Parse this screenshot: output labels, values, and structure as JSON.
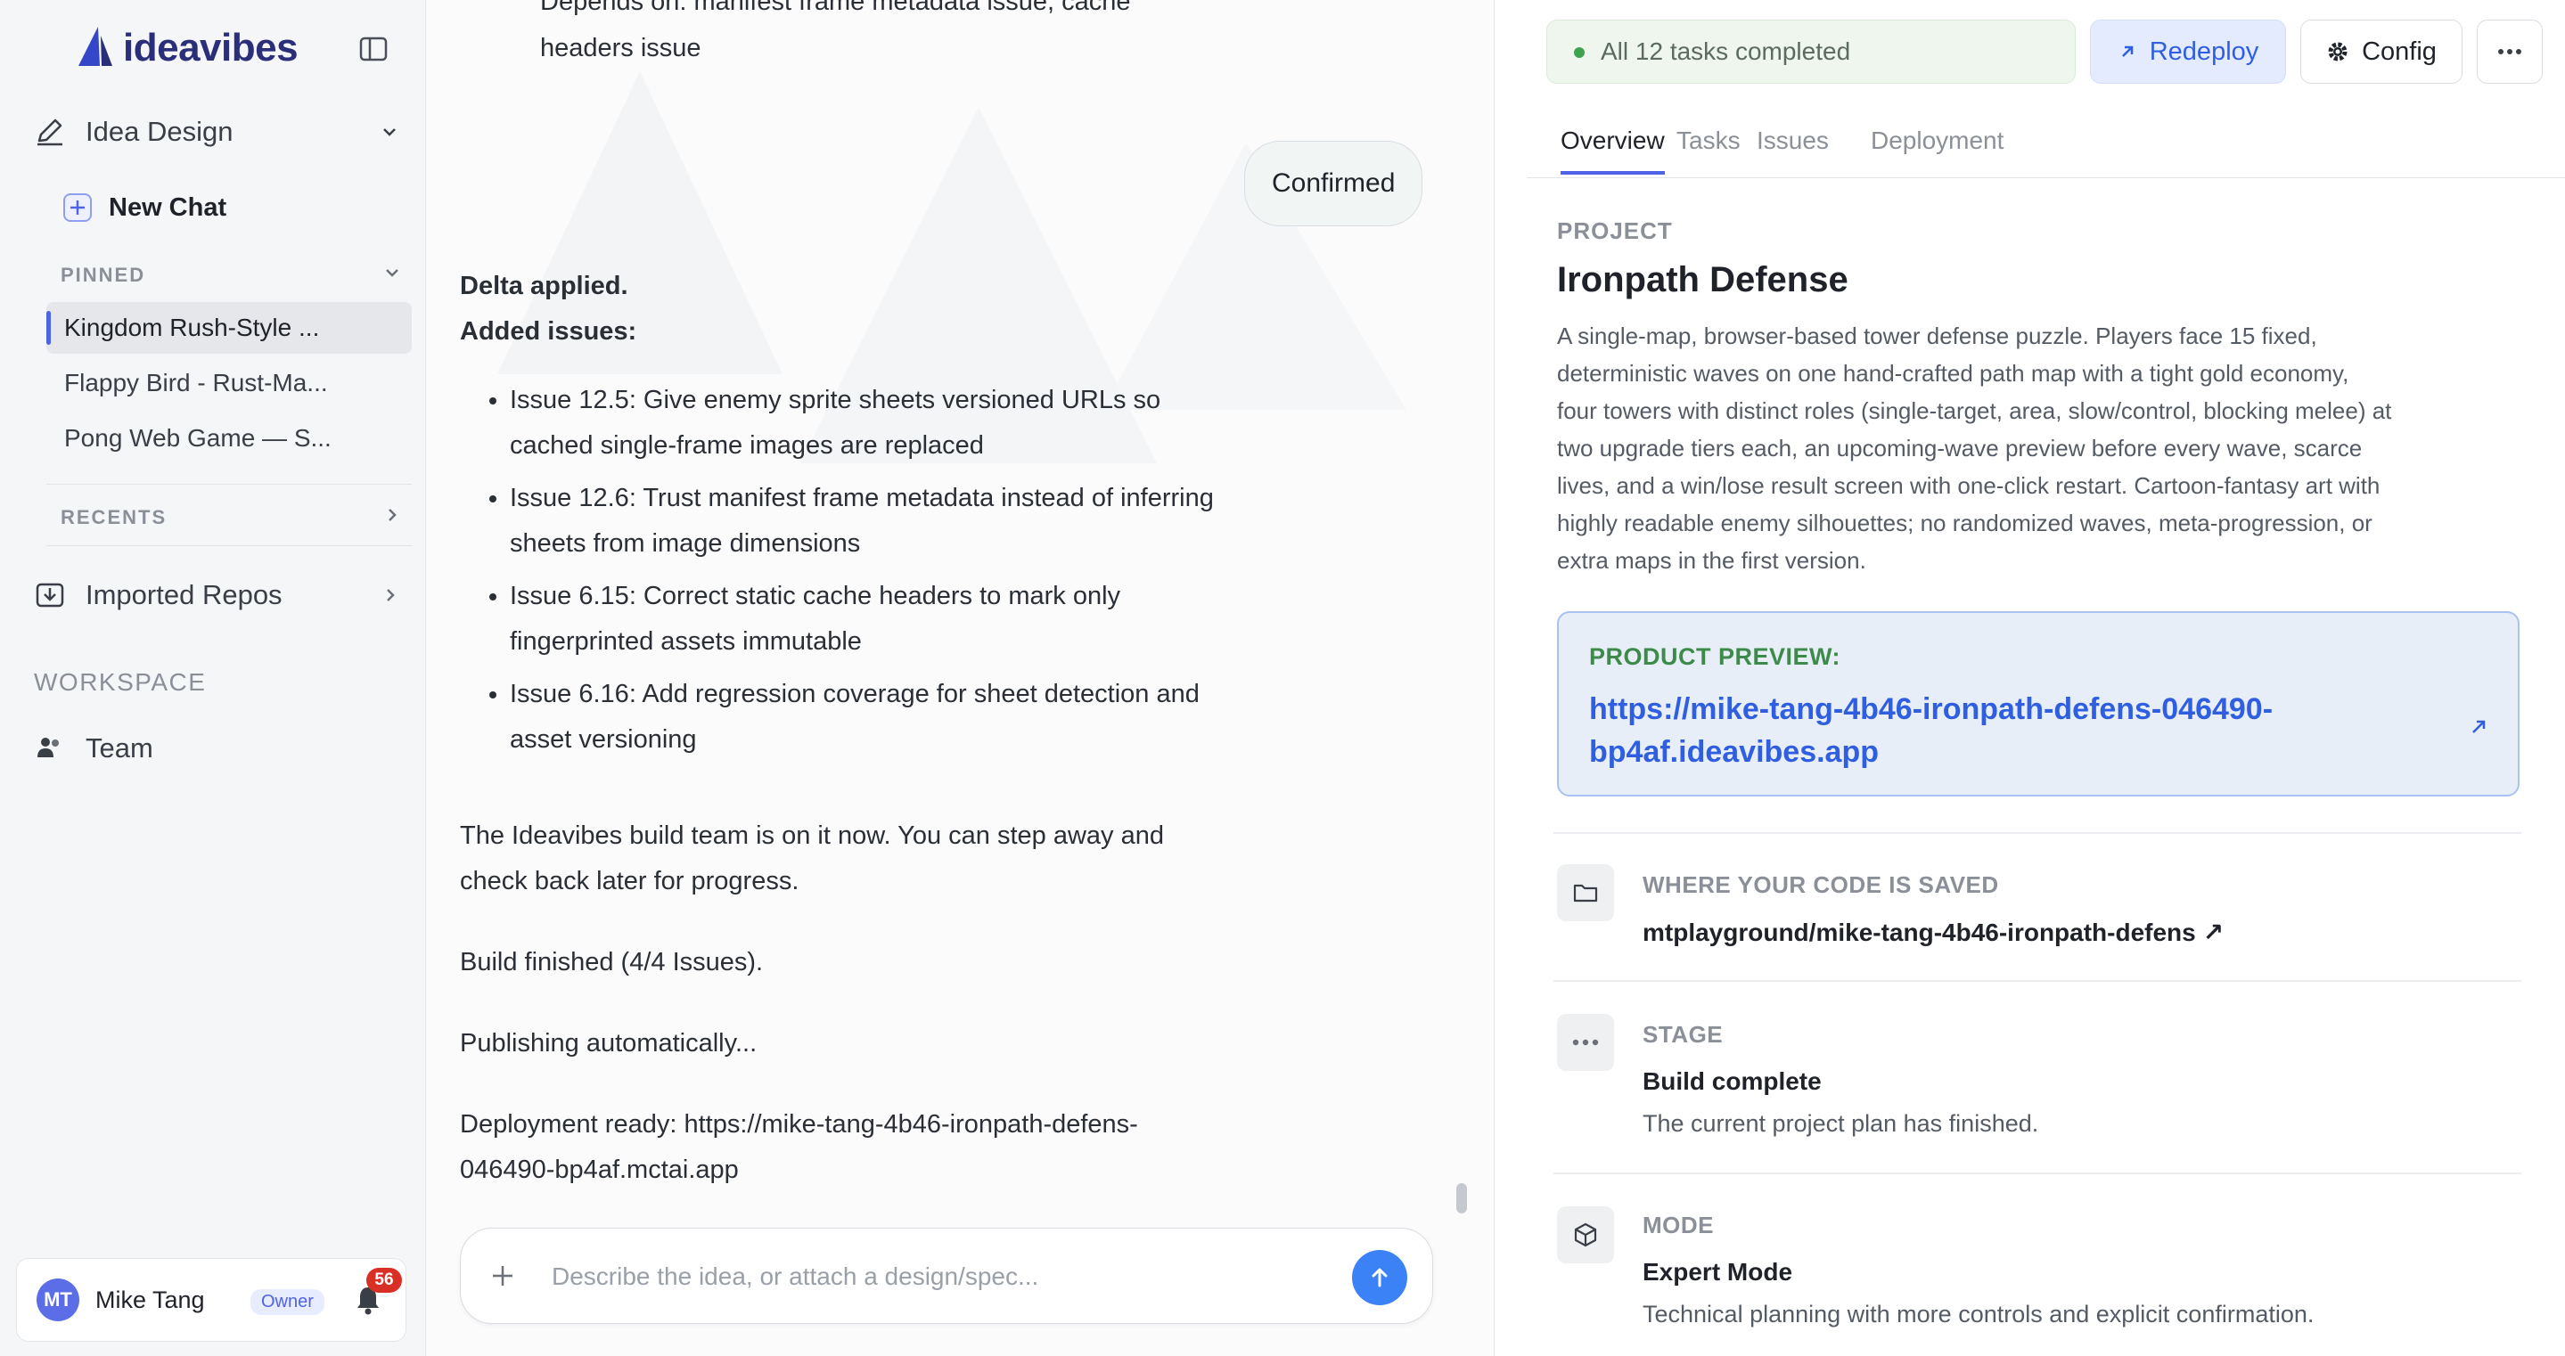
{
  "brand": {
    "name": "ideavibes"
  },
  "sidebar": {
    "project_label": "Idea Design",
    "new_chat_label": "New Chat",
    "pinned_label": "PINNED",
    "pinned_items": [
      {
        "label": "Kingdom Rush-Style ..."
      },
      {
        "label": "Flappy Bird - Rust-Ma..."
      },
      {
        "label": "Pong Web Game — S..."
      }
    ],
    "recents_label": "RECENTS",
    "imported_repos_label": "Imported Repos",
    "workspace_label": "WORKSPACE",
    "team_label": "Team",
    "user": {
      "initials": "MT",
      "name": "Mike Tang",
      "role": "Owner",
      "notifications": "56"
    }
  },
  "chat": {
    "top_fragment_1": "Depends on: manifest frame metadata issue, cache",
    "top_fragment_2": "headers issue",
    "confirmed_label": "Confirmed",
    "delta_applied": "Delta applied.",
    "added_issues": "Added issues:",
    "issues": [
      {
        "line1": "Issue 12.5: Give enemy sprite sheets versioned URLs so",
        "line2": "cached single-frame images are replaced"
      },
      {
        "line1": "Issue 12.6: Trust manifest frame metadata instead of inferring",
        "line2": "sheets from image dimensions"
      },
      {
        "line1": "Issue 6.15: Correct static cache headers to mark only",
        "line2": "fingerprinted assets immutable"
      },
      {
        "line1": "Issue 6.16: Add regression coverage for sheet detection and",
        "line2": "asset versioning"
      }
    ],
    "build_team_1": "The Ideavibes build team is on it now. You can step away and",
    "build_team_2": "check back later for progress.",
    "build_finished": "Build finished (4/4 Issues).",
    "publishing": "Publishing automatically...",
    "deploy_ready_1": "Deployment ready: https://mike-tang-4b46-ironpath-defens-",
    "deploy_ready_2": "046490-bp4af.mctai.app",
    "composer_placeholder": "Describe the idea, or attach a design/spec..."
  },
  "panel": {
    "status": "All 12 tasks completed",
    "redeploy_label": "Redeploy",
    "config_label": "Config",
    "tabs": [
      "Overview",
      "Tasks",
      "Issues",
      "Deployment"
    ],
    "project_label": "PROJECT",
    "project_title": "Ironpath Defense",
    "project_desc_lines": [
      "A single-map, browser-based tower defense puzzle. Players face 15 fixed,",
      "deterministic waves on one hand-crafted path map with a tight gold economy,",
      "four towers with distinct roles (single-target, area, slow/control, blocking melee) at",
      "two upgrade tiers each, an upcoming-wave preview before every wave, scarce",
      "lives, and a win/lose result screen with one-click restart. Cartoon-fantasy art with",
      "highly readable enemy silhouettes; no randomized waves, meta-progression, or",
      "extra maps in the first version."
    ],
    "preview_label": "PRODUCT PREVIEW:",
    "preview_url_1": "https://mike-tang-4b46-ironpath-defens-046490-",
    "preview_url_2": "bp4af.ideavibes.app",
    "code_label": "WHERE YOUR CODE IS SAVED",
    "code_repo": "mtplayground/mike-tang-4b46-ironpath-defens ↗",
    "stage_label": "STAGE",
    "stage_value": "Build complete",
    "stage_sub": "The current project plan has finished.",
    "mode_label": "MODE",
    "mode_value": "Expert Mode",
    "mode_sub": "Technical planning with more controls and explicit confirmation."
  },
  "colors": {
    "accent": "#4f63e6",
    "link": "#2f5fe0",
    "success": "#3fa34d",
    "badge": "#d93025"
  }
}
